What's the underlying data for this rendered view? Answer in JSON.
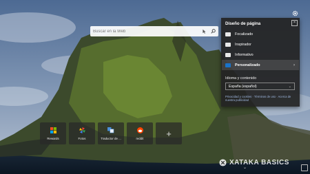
{
  "search": {
    "placeholder": "Buscar en la Web"
  },
  "panel": {
    "title": "Diseño de página",
    "options": [
      {
        "label": "Focalizado"
      },
      {
        "label": "Inspirador"
      },
      {
        "label": "Informativo"
      },
      {
        "label": "Personalizado",
        "selected": true
      }
    ],
    "language_label": "Idioma y contenido",
    "language_value": "España (español)",
    "footer": "Privacidad y cookies · Términos de uso · Acerca de nuestra publicidad"
  },
  "quick_links": [
    {
      "label": "Rewards",
      "icon": "windows-logo-icon"
    },
    {
      "label": "Fotos",
      "icon": "photos-pinwheel-icon"
    },
    {
      "label": "Traductor de ...",
      "icon": "translator-icon"
    },
    {
      "label": "reddit",
      "icon": "reddit-icon"
    }
  ],
  "watermark": "XATAKA BASICS",
  "colors": {
    "accent": "#1a73c8",
    "panel": "#242424"
  }
}
